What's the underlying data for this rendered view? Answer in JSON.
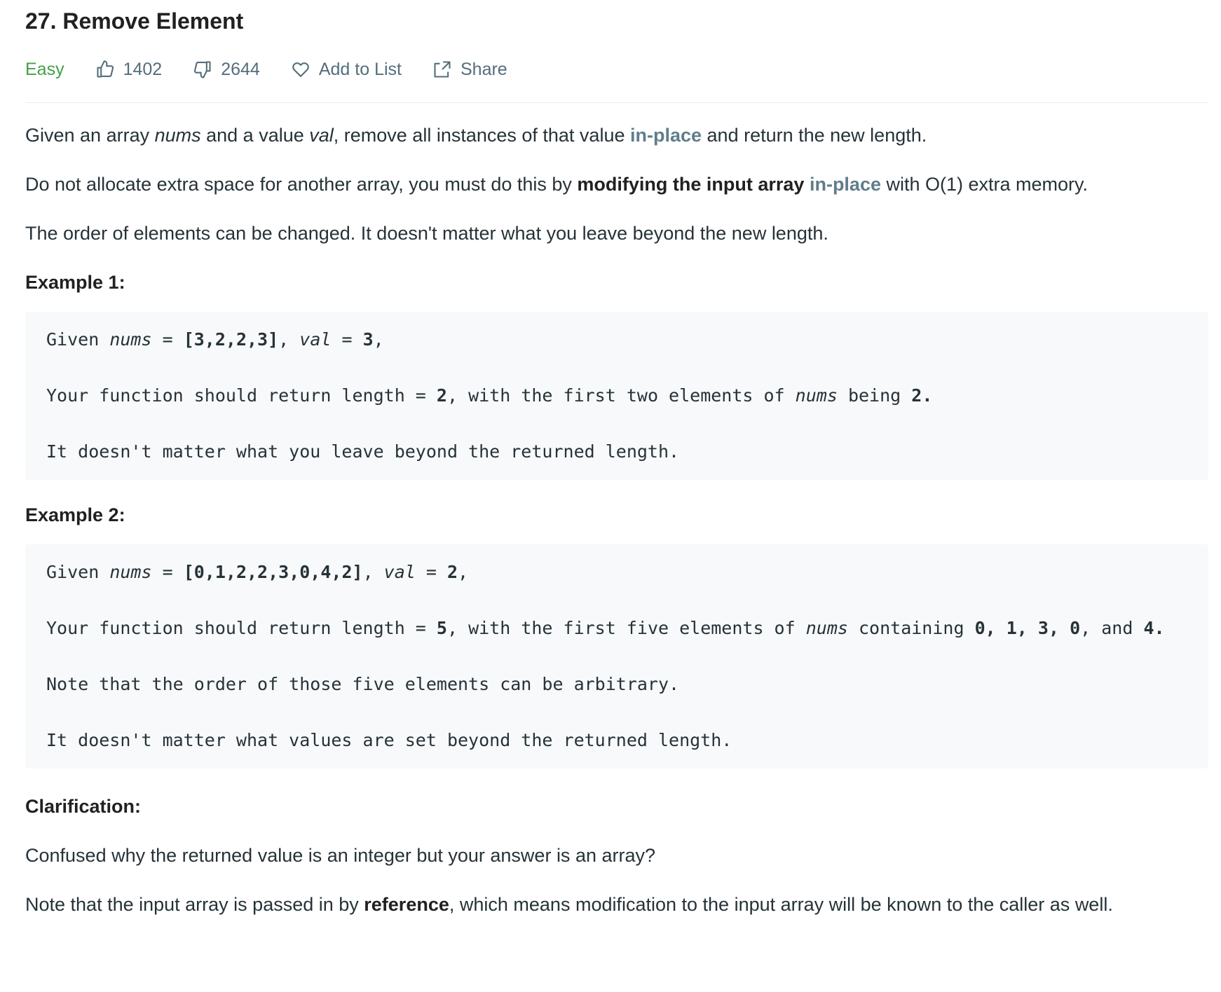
{
  "problem": {
    "title": "27. Remove Element",
    "difficulty": "Easy",
    "likes": "1402",
    "dislikes": "2644",
    "add_to_list": "Add to List",
    "share": "Share"
  },
  "description": {
    "p1": {
      "a": "Given an array ",
      "nums": "nums",
      "b": " and a value ",
      "val": "val",
      "c": ", remove all instances of that value ",
      "link": "in-place",
      "d": " and return the new length."
    },
    "p2": {
      "a": "Do not allocate extra space for another array, you must do this by ",
      "strong": "modifying the input array",
      "space": " ",
      "link": "in-place",
      "b": " with O(1) extra memory."
    },
    "p3": "The order of elements can be changed. It doesn't matter what you leave beyond the new length."
  },
  "example1": {
    "title": "Example 1:",
    "l1": {
      "a": "Given ",
      "nums": "nums",
      "b": " = ",
      "arr": "[3,2,2,3]",
      "c": ", ",
      "val": "val",
      "d": " = ",
      "v": "3",
      "e": ","
    },
    "l2": {
      "a": "Your function should return length = ",
      "len": "2",
      "b": ", with the first two elements of ",
      "nums": "nums",
      "c": " being ",
      "v": "2",
      "d": "."
    },
    "l3": "It doesn't matter what you leave beyond the returned length."
  },
  "example2": {
    "title": "Example 2:",
    "l1": {
      "a": "Given ",
      "nums": "nums",
      "b": " = ",
      "arr": "[0,1,2,2,3,0,4,2]",
      "c": ", ",
      "val": "val",
      "d": " = ",
      "v": "2",
      "e": ","
    },
    "l2": {
      "a": "Your function should return length = ",
      "len": "5",
      "b": ", with the first five elements of ",
      "nums": "nums",
      "c": " containing ",
      "v1": "0",
      "s1": ", ",
      "v2": "1",
      "s2": ", ",
      "v3": "3",
      "s3": ", ",
      "v4": "0",
      "s4": ", and ",
      "v5": "4",
      "d": "."
    },
    "l3": "Note that the order of those five elements can be arbitrary.",
    "l4": "It doesn't matter what values are set beyond the returned length."
  },
  "clarification": {
    "title": "Clarification:",
    "p1": "Confused why the returned value is an integer but your answer is an array?",
    "p2": {
      "a": "Note that the input array is passed in by ",
      "strong": "reference",
      "b": ", which means modification to the input array will be known to the caller as well."
    }
  },
  "colors": {
    "difficulty_easy": "#43a047",
    "link": "#607d8b",
    "code_bg": "#f7f9fa",
    "meta_text": "#546e7a"
  },
  "icons": [
    "thumbs-up-icon",
    "thumbs-down-icon",
    "heart-icon",
    "share-icon"
  ]
}
